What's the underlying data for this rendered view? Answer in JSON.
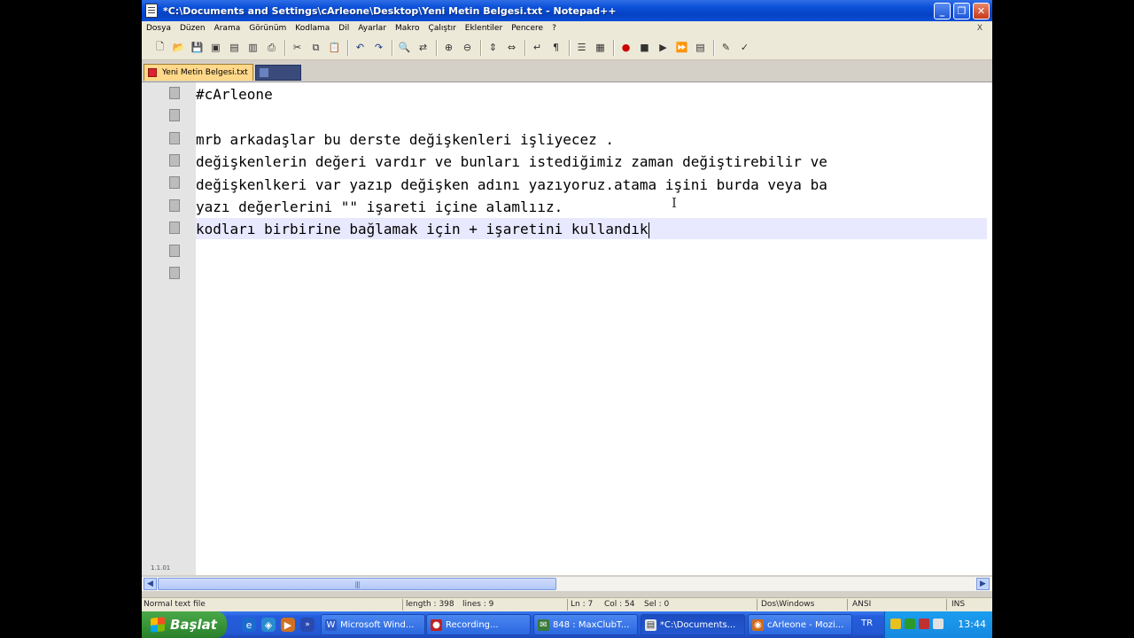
{
  "window": {
    "title": "*C:\\Documents and Settings\\cArleone\\Desktop\\Yeni Metin Belgesi.txt - Notepad++",
    "buttons": [
      "minimize",
      "maximize",
      "close"
    ]
  },
  "menu": {
    "items": [
      "Dosya",
      "Düzen",
      "Arama",
      "Görünüm",
      "Kodlama",
      "Dil",
      "Ayarlar",
      "Makro",
      "Çalıştır",
      "Eklentiler",
      "Pencere",
      "?"
    ],
    "close_glyph": "X"
  },
  "toolbar": {
    "icons": [
      "new-icon",
      "open-icon",
      "save-icon",
      "save-all-icon",
      "close-icon",
      "close-all-icon",
      "print-icon",
      "cut-icon",
      "copy-icon",
      "paste-icon",
      "undo-icon",
      "redo-icon",
      "find-icon",
      "replace-icon",
      "zoom-in-icon",
      "zoom-out-icon",
      "sync-v-icon",
      "sync-h-icon",
      "wrap-icon",
      "all-chars-icon",
      "indent-guide-icon",
      "doc-map-icon",
      "record-macro-icon",
      "stop-macro-icon",
      "play-macro-icon",
      "run-macro-multiple-icon",
      "save-macro-icon",
      "spellcheck-icon",
      "settings-icon"
    ]
  },
  "tabs": [
    {
      "label": "Yeni Metin Belgesi.txt",
      "active": true
    },
    {
      "label": "",
      "active": false
    }
  ],
  "editor": {
    "lines": [
      "#cArleone",
      "",
      "mrb arkadaşlar bu derste değişkenleri işliyecez .",
      "değişkenlerin değeri vardır ve bunları istediğimiz zaman değiştirebilir ve",
      "değişkenlkeri var yazıp değişken adını yazıyoruz.atama işini burda veya ba",
      "yazı değerlerini \"\" işareti içine alamlıız.",
      "kodları birbirine bağlamak için + işaretini kullandık"
    ],
    "current_line": 7,
    "gutter_markers": 9,
    "gutter_footer": "1.1.01"
  },
  "status": {
    "doc_type": "Normal text file",
    "length": "length : 398",
    "lines": "lines : 9",
    "ln": "Ln : 7",
    "col": "Col : 54",
    "sel": "Sel : 0",
    "eol": "Dos\\Windows",
    "encoding": "ANSI",
    "mode": "INS"
  },
  "taskbar": {
    "start_label": "Başlat",
    "buttons": [
      {
        "label": "Microsoft Wind...",
        "active": false
      },
      {
        "label": "Recording...",
        "active": false
      },
      {
        "label": "848 : MaxClubT...",
        "active": false
      },
      {
        "label": "*C:\\Documents...",
        "active": true
      },
      {
        "label": "cArleone - Mozi...",
        "active": false
      }
    ],
    "language": "TR",
    "clock": "13:44"
  },
  "colors": {
    "titlebar": "#0a4fd8",
    "current_line": "#e8e8ff",
    "tab_active": "#ffd88a",
    "taskbar": "#245ddc",
    "start": "#3c9a3c"
  }
}
